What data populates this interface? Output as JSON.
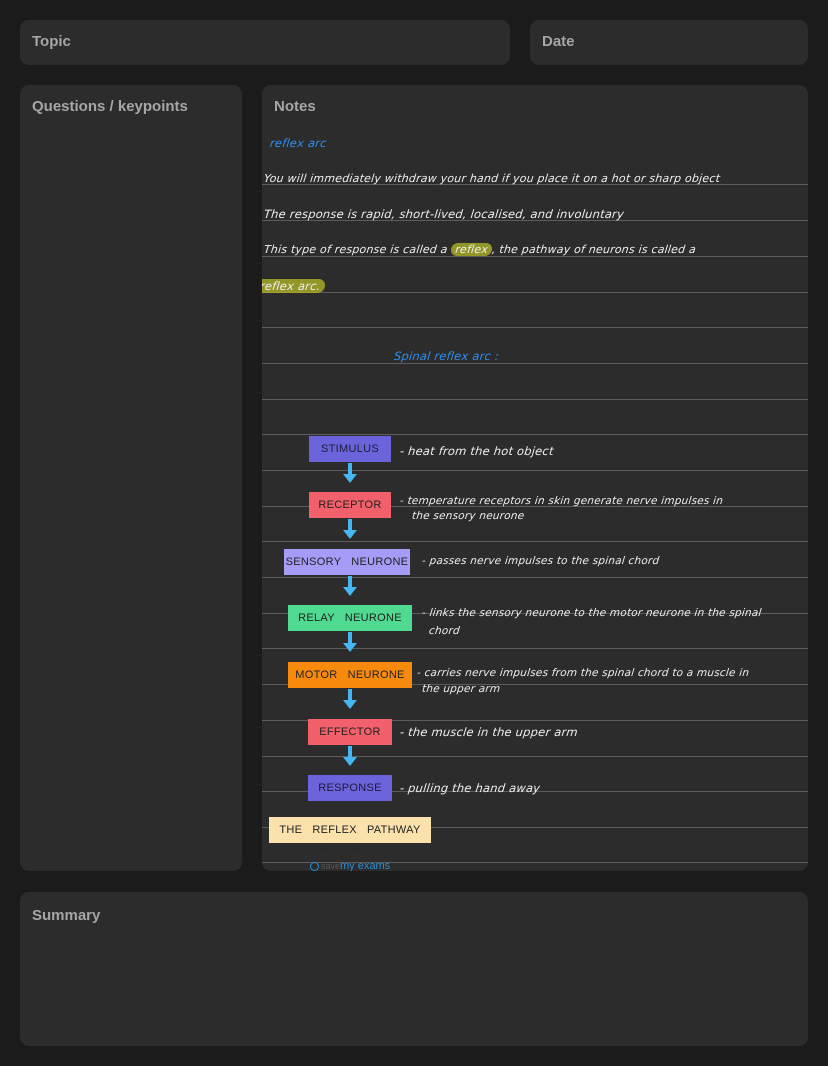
{
  "panels": {
    "topic": "Topic",
    "date": "Date",
    "questions": "Questions / keypoints",
    "notes": "Notes",
    "summary": "Summary"
  },
  "notes": {
    "heading": "reflex arc",
    "line1": "You will immediately withdraw your hand if you place it on a hot or sharp object",
    "line2": "The response is rapid, short-lived, localised, and involuntary",
    "line3_a": "This type of response is called a",
    "line3_highlight": "reflex",
    "line3_b": ", the pathway of neurons is called a",
    "line4_highlight": "reflex arc.",
    "subheading": "Spinal reflex arc :"
  },
  "pathway": {
    "nodes": [
      {
        "label": "STIMULUS",
        "color": "#6b63d9",
        "note": "- heat from the hot object",
        "note2": ""
      },
      {
        "label": "RECEPTOR",
        "color": "#f2606b",
        "note": "- temperature receptors in skin generate nerve impulses in",
        "note2": "the sensory neurone"
      },
      {
        "label": "SENSORY   NEURONE",
        "color": "#a59cf7",
        "note": "- passes nerve impulses to the spinal chord",
        "note2": ""
      },
      {
        "label": "RELAY   NEURONE",
        "color": "#4fd991",
        "note": "- links the sensory neurone to the motor neurone in the spinal",
        "note2": "chord"
      },
      {
        "label": "MOTOR   NEURONE",
        "color": "#f78a0d",
        "note": "- carries nerve impulses from the spinal chord to a muscle in",
        "note2": "the upper arm"
      },
      {
        "label": "EFFECTOR",
        "color": "#f2606b",
        "note": "- the muscle in the upper arm",
        "note2": ""
      },
      {
        "label": "RESPONSE",
        "color": "#6b63d9",
        "note": "- pulling the hand away",
        "note2": ""
      }
    ],
    "caption": "THE   REFLEX   PATHWAY",
    "caption_color": "#fbe2ad"
  },
  "watermark": {
    "brand_prefix": "save",
    "brand": "my exams"
  }
}
